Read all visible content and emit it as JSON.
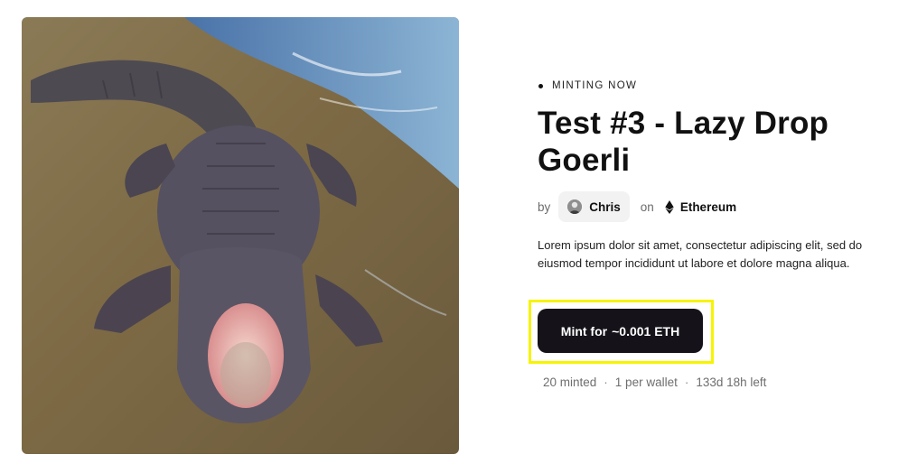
{
  "drop": {
    "status_label": "MINTING NOW",
    "title": "Test #3 - Lazy Drop Goerli",
    "by_label": "by",
    "creator_name": "Chris",
    "on_label": "on",
    "chain_name": "Ethereum",
    "description": "Lorem ipsum dolor sit amet, consectetur adipiscing elit, sed do eiusmod tempor incididunt ut labore et dolore magna aliqua.",
    "mint_label": "Mint for",
    "mint_price": "~0.001 ETH",
    "stats": {
      "minted": "20 minted",
      "per_wallet": "1 per wallet",
      "time_left": "133d 18h left",
      "separator": "·"
    }
  },
  "artwork": {
    "subject": "alligator-photo"
  },
  "colors": {
    "button_bg": "#151319",
    "highlight": "#f7f400",
    "chip_bg": "#f2f2f3"
  }
}
